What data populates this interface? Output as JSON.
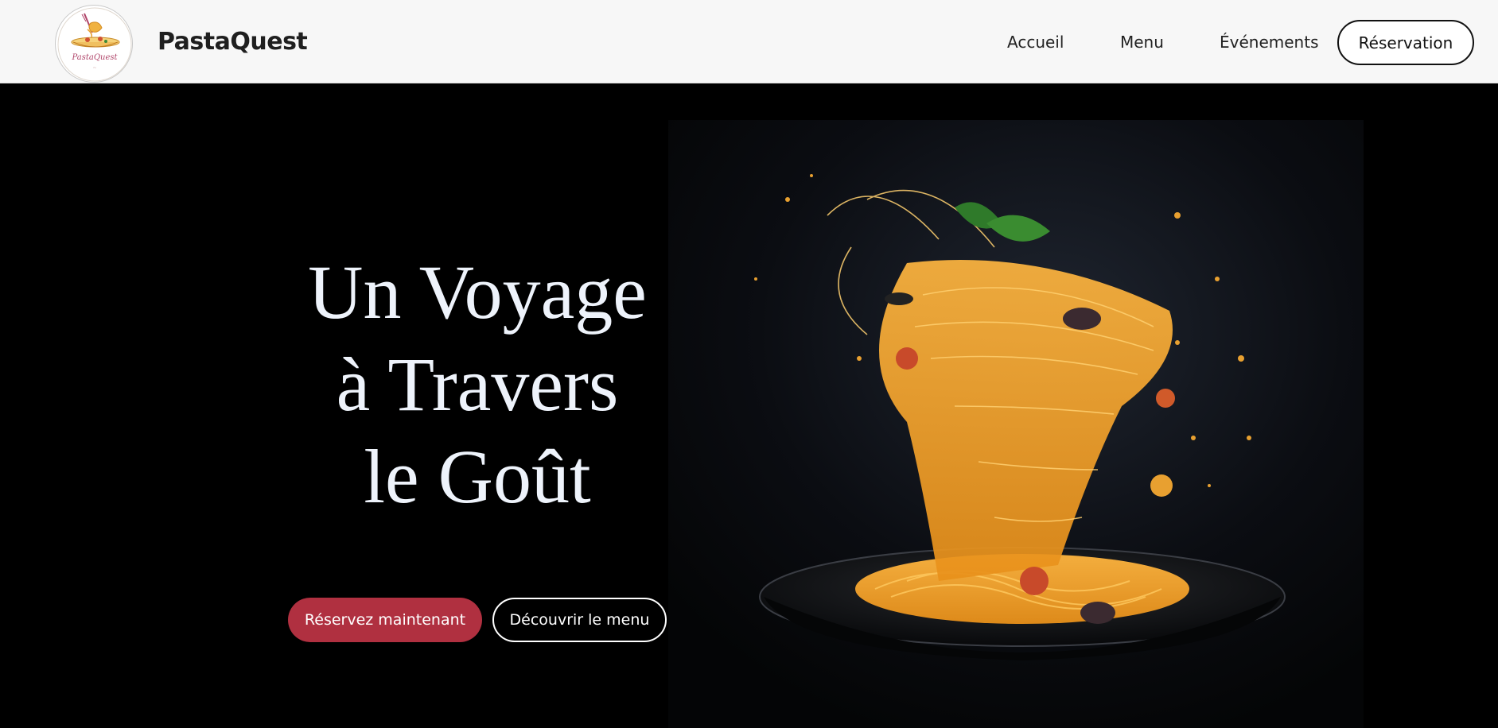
{
  "brand": {
    "name": "PastaQuest",
    "logo_text": "PastaQuest"
  },
  "nav": {
    "items": [
      {
        "label": "Accueil"
      },
      {
        "label": "Menu"
      },
      {
        "label": "Événements"
      }
    ],
    "cta_label": "Réservation"
  },
  "hero": {
    "title_lines": [
      "Un Voyage",
      "à Travers",
      "le Goût"
    ],
    "primary_button": "Réservez maintenant",
    "secondary_button": "Découvrir le menu",
    "image_alt": "spaghetti-plate-image"
  },
  "colors": {
    "navbar_bg": "#f7f7f7",
    "hero_bg": "#000000",
    "accent": "#b03040",
    "title_text": "#eef3fb"
  }
}
